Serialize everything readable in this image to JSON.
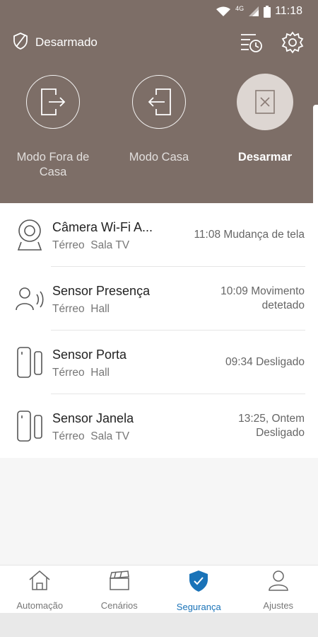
{
  "status_bar": {
    "time": "11:18",
    "network": "4G"
  },
  "header": {
    "security_status": "Desarmado",
    "modes": [
      {
        "label": "Modo Fora de Casa",
        "icon": "exit-door-icon",
        "active": false
      },
      {
        "label": "Modo Casa",
        "icon": "enter-door-icon",
        "active": false
      },
      {
        "label": "Desarmar",
        "icon": "disarm-icon",
        "active": true
      }
    ]
  },
  "devices": [
    {
      "name": "Câmera Wi-Fi A...",
      "floor": "Térreo",
      "room": "Sala TV",
      "event_line1": "11:08 Mudança de tela",
      "event_line2": "",
      "icon": "camera-icon"
    },
    {
      "name": "Sensor Presença",
      "floor": "Térreo",
      "room": "Hall",
      "event_line1": "10:09 Movimento",
      "event_line2": "detetado",
      "icon": "motion-sensor-icon"
    },
    {
      "name": "Sensor Porta",
      "floor": "Térreo",
      "room": "Hall",
      "event_line1": "09:34 Desligado",
      "event_line2": "",
      "icon": "door-sensor-icon"
    },
    {
      "name": "Sensor Janela",
      "floor": "Térreo",
      "room": "Sala TV",
      "event_line1": "13:25, Ontem",
      "event_line2": "Desligado",
      "icon": "window-sensor-icon"
    }
  ],
  "bottom_nav": [
    {
      "label": "Automação",
      "icon": "home-icon",
      "active": false
    },
    {
      "label": "Cenários",
      "icon": "clapperboard-icon",
      "active": false
    },
    {
      "label": "Segurança",
      "icon": "shield-check-icon",
      "active": true
    },
    {
      "label": "Ajustes",
      "icon": "user-icon",
      "active": false
    }
  ],
  "colors": {
    "header_bg": "#7d6e67",
    "accent": "#1a73b8",
    "active_mode_bg": "#ddd6d2"
  }
}
